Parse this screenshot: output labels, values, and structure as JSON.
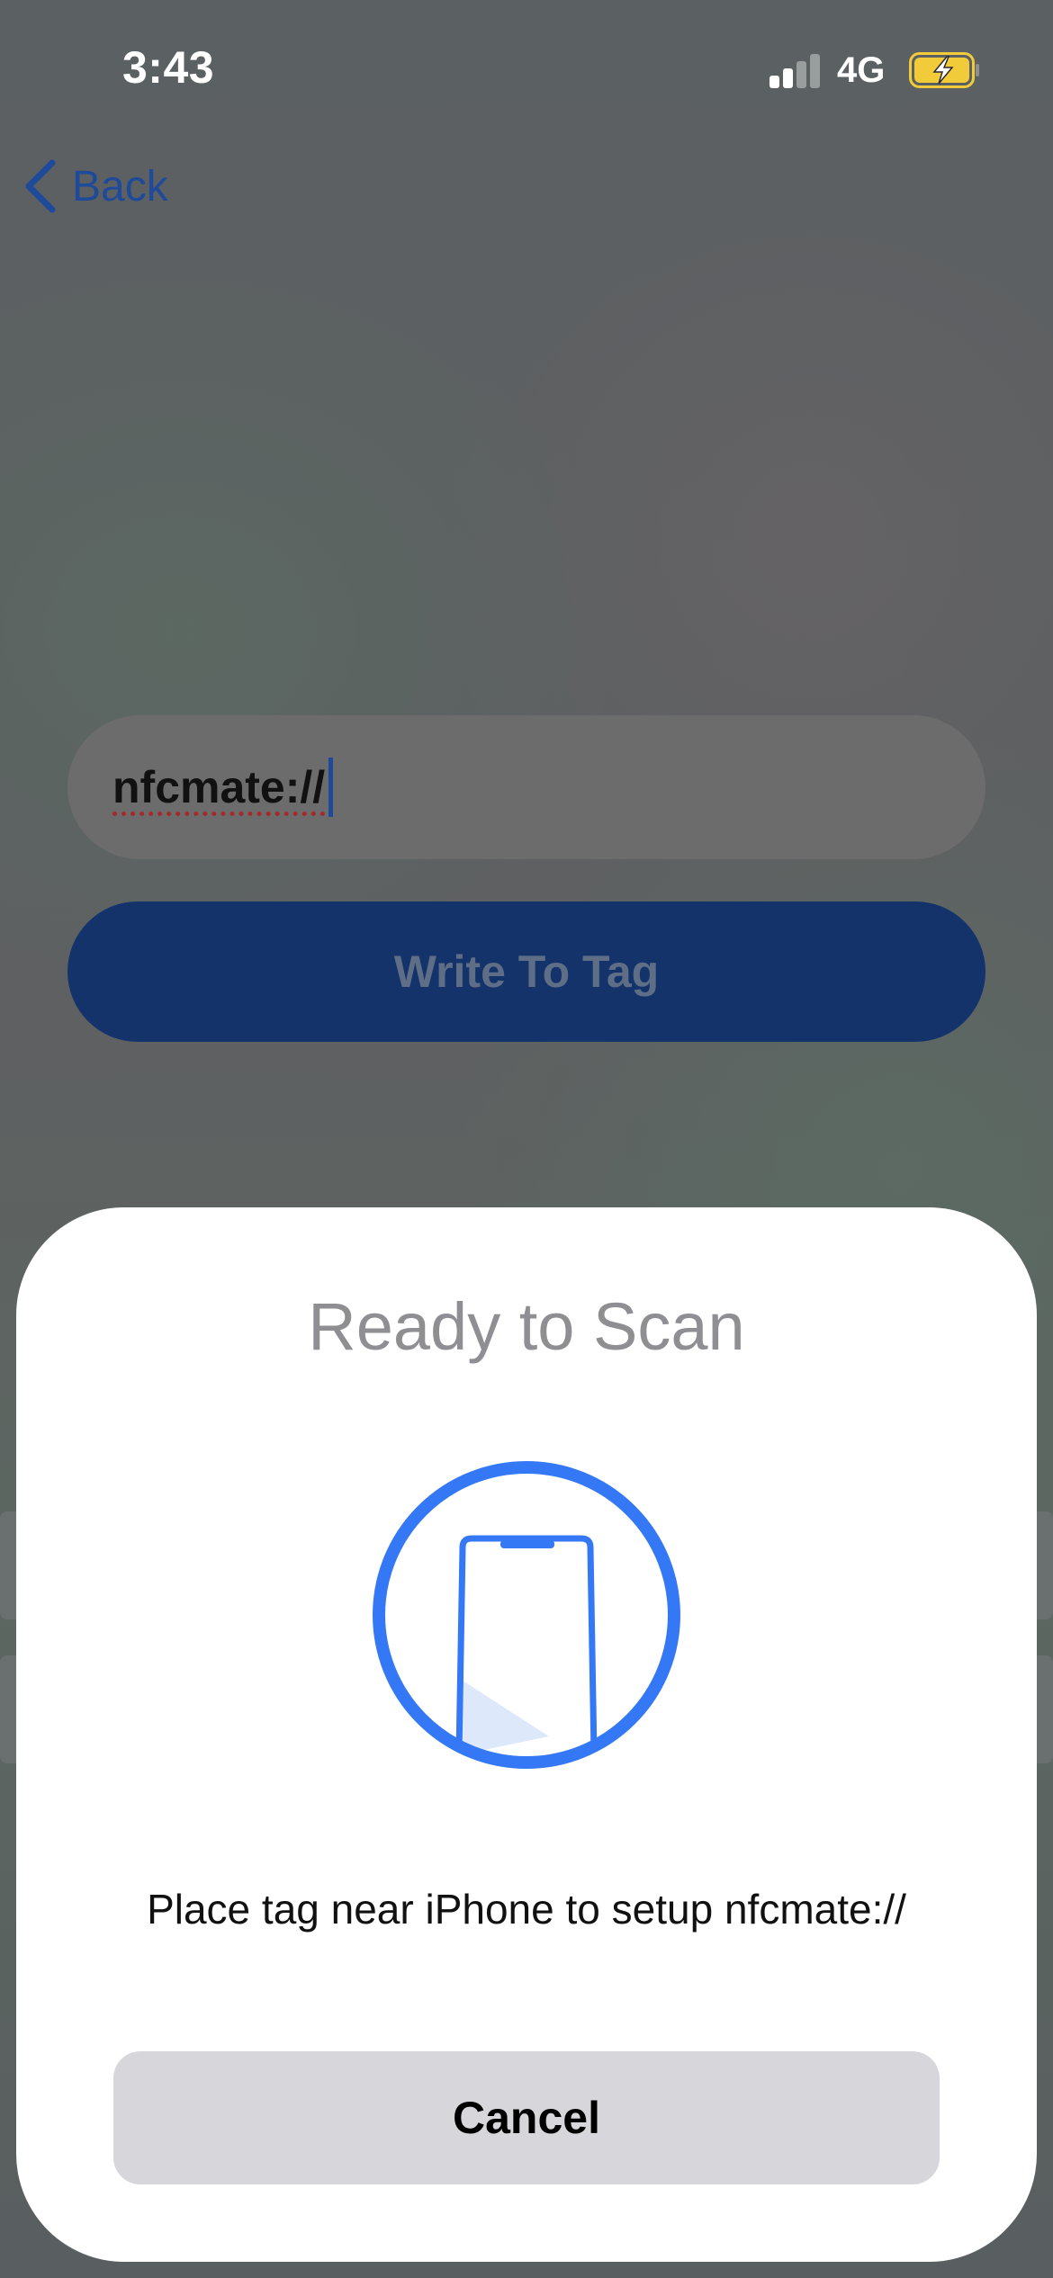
{
  "status_bar": {
    "time": "3:43",
    "network": "4G",
    "signal_bars_active": 2,
    "signal_bars_total": 4,
    "battery_charging": true
  },
  "nav": {
    "back_label": "Back"
  },
  "form": {
    "url_value": "nfcmate://",
    "write_button_label": "Write To Tag"
  },
  "scan_sheet": {
    "title": "Ready to Scan",
    "message": "Place tag near iPhone to setup nfcmate://",
    "cancel_label": "Cancel"
  },
  "icons": {
    "back": "chevron-left-icon",
    "scan": "phone-scan-icon",
    "signal": "cellular-signal-icon",
    "battery": "battery-charging-icon"
  },
  "colors": {
    "accent_blue": "#3478f6",
    "button_dark_blue": "#14336b",
    "battery_yellow": "#f2cb3a",
    "sheet_bg": "#ffffff",
    "cancel_bg": "#d6d6db"
  }
}
